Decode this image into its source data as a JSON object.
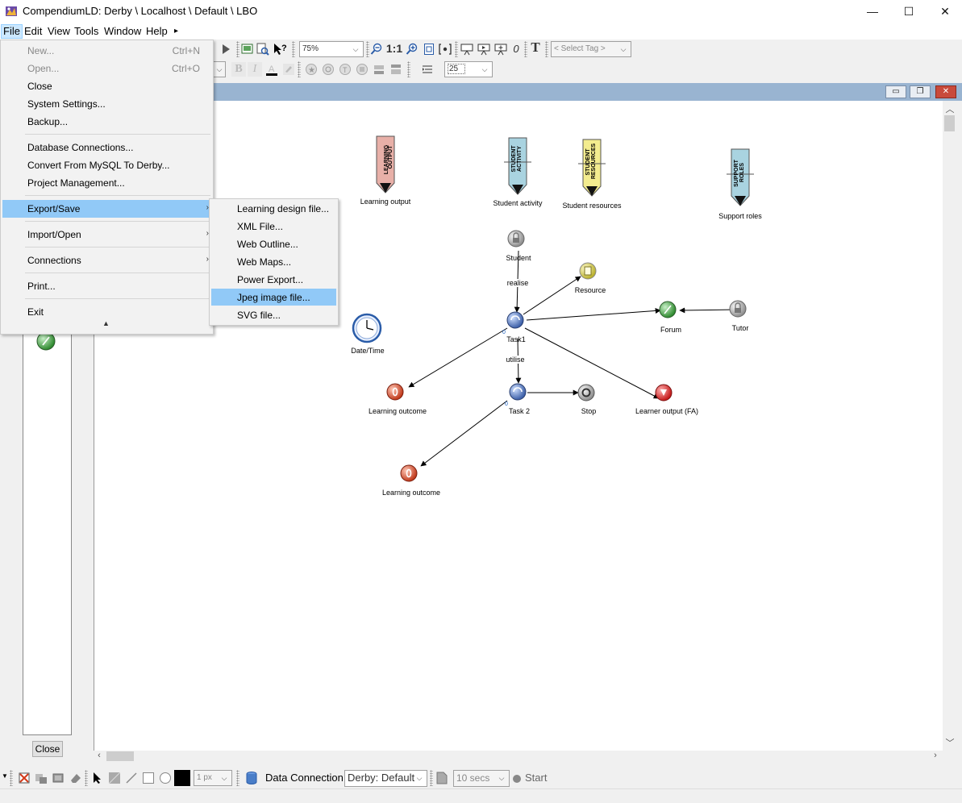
{
  "window": {
    "title": "CompendiumLD: Derby \\ Localhost \\ Default \\ LBO",
    "minimize_glyph": "—",
    "maximize_glyph": "☐",
    "close_glyph": "✕"
  },
  "menubar": {
    "items": [
      "File",
      "Edit",
      "View",
      "Tools",
      "Window",
      "Help"
    ],
    "overflow_glyph": "▸"
  },
  "toolbar": {
    "zoom_value": "75%",
    "zoom_reset_label": "1:1",
    "counter_value": "0",
    "text_tool_label": "T",
    "select_tag_placeholder": "< Select Tag >",
    "font_size_value": "25",
    "bold_label": "B",
    "italic_label": "I"
  },
  "file_menu": {
    "items": [
      {
        "label": "New...",
        "shortcut": "Ctrl+N",
        "disabled": true
      },
      {
        "label": "Open...",
        "shortcut": "Ctrl+O",
        "disabled": true
      },
      {
        "label": "Close",
        "shortcut": ""
      },
      {
        "label": "System Settings...",
        "shortcut": ""
      },
      {
        "label": "Backup...",
        "shortcut": ""
      },
      {
        "label": "Database Connections...",
        "shortcut": ""
      },
      {
        "label": "Convert From MySQL To Derby...",
        "shortcut": ""
      },
      {
        "label": "Project Management...",
        "shortcut": ""
      },
      {
        "label": "Export/Save",
        "submenu": true,
        "highlighted": true
      },
      {
        "label": "Import/Open",
        "submenu": true
      },
      {
        "label": "Connections",
        "submenu": true
      },
      {
        "label": "Print...",
        "shortcut": ""
      },
      {
        "label": "Exit",
        "shortcut": ""
      }
    ],
    "scroll_glyph": "▲"
  },
  "export_menu": {
    "items": [
      "Learning design file...",
      "XML File...",
      "Web Outline...",
      "Web Maps...",
      "Power Export...",
      "Jpeg image file...",
      "SVG file..."
    ],
    "highlighted_index": 5
  },
  "diagram": {
    "role_nodes": [
      {
        "banner": "LEARNING OUTPUT",
        "label": "Learning output",
        "color": "#e8b0a8"
      },
      {
        "banner": "STUDENT ACTIVITY",
        "label": "Student activity",
        "color": "#a9d3e0"
      },
      {
        "banner": "STUDENT RESOURCES",
        "label": "Student resources",
        "color": "#f3ec8f"
      },
      {
        "banner": "SUPPORT ROLES",
        "label": "Support roles",
        "color": "#a9d3e0"
      }
    ],
    "nodes": [
      {
        "label": "Student",
        "icon": "lock-icon"
      },
      {
        "label": "Resource",
        "icon": "document-icon"
      },
      {
        "label": "Task1",
        "icon": "task-icon",
        "badge": "0"
      },
      {
        "label": "Forum",
        "icon": "forum-icon"
      },
      {
        "label": "Tutor",
        "icon": "lock-icon"
      },
      {
        "label": "Date/Time",
        "icon": "clock-icon"
      },
      {
        "label": "Learning outcome",
        "icon": "outcome-icon"
      },
      {
        "label": "Task 2",
        "icon": "task-icon",
        "badge": "0"
      },
      {
        "label": "Stop",
        "icon": "stop-icon"
      },
      {
        "label": "Learner output (FA)",
        "icon": "output-icon"
      },
      {
        "label": "Learning outcome",
        "icon": "outcome-icon"
      }
    ],
    "link_labels": [
      "realise",
      "utilise"
    ]
  },
  "palette": {
    "close_label": "Close"
  },
  "statusbar": {
    "line_width": "1 px",
    "data_connection_label": "Data Connection:",
    "data_connection_value": "Derby: Default",
    "refresh_interval": "10 secs",
    "start_label": "Start"
  },
  "colors": {
    "menu_highlight": "#91c9f7",
    "doc_titlebar": "#99b4d1"
  }
}
